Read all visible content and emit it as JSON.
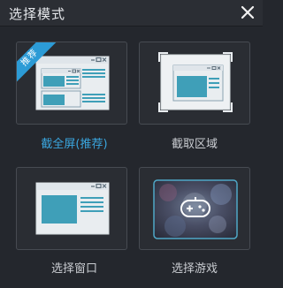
{
  "window": {
    "title": "选择模式"
  },
  "modes": [
    {
      "label": "截全屏(推荐)",
      "badge": "推荐",
      "active": true
    },
    {
      "label": "截取区域"
    },
    {
      "label": "选择窗口"
    },
    {
      "label": "选择游戏"
    }
  ],
  "colors": {
    "accent": "#3aa6df",
    "window_bg": "#24272d",
    "illustration_teal": "#3f9fb8"
  },
  "icons": {
    "close": "close-icon",
    "gamepad": "gamepad-icon"
  }
}
